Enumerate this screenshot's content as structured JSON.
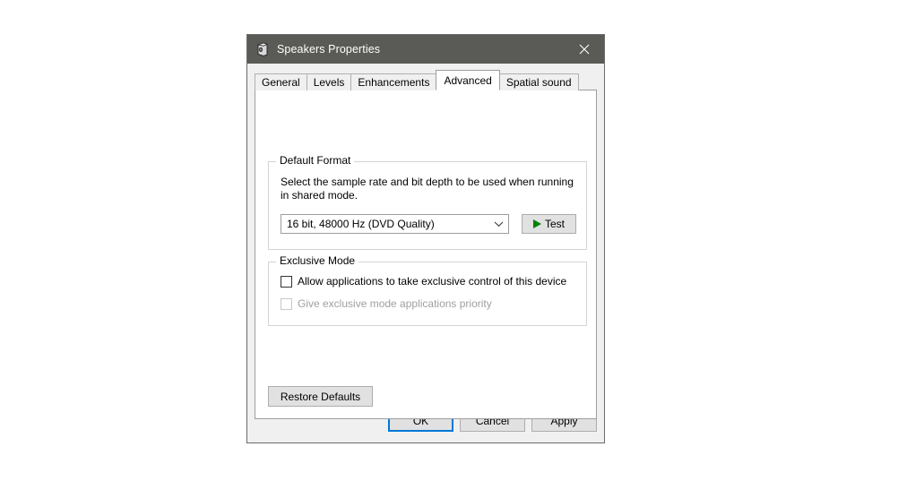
{
  "window": {
    "title": "Speakers Properties",
    "icon": "speaker-device-icon",
    "close_label": "✕",
    "titlebar_color": "#5a5a56"
  },
  "tabs": [
    {
      "label": "General",
      "selected": false
    },
    {
      "label": "Levels",
      "selected": false
    },
    {
      "label": "Enhancements",
      "selected": false
    },
    {
      "label": "Advanced",
      "selected": true
    },
    {
      "label": "Spatial sound",
      "selected": false
    }
  ],
  "default_format": {
    "group_label": "Default Format",
    "description": "Select the sample rate and bit depth to be used when running in shared mode.",
    "combo": {
      "selected": "16 bit, 48000 Hz (DVD Quality)",
      "arrow_icon": "chevron-down-icon"
    },
    "test_button": {
      "label": "Test",
      "icon": "play-icon",
      "icon_color": "#008000"
    }
  },
  "exclusive_mode": {
    "group_label": "Exclusive Mode",
    "checkboxes": [
      {
        "label": "Allow applications to take exclusive control of this device",
        "checked": false,
        "enabled": true
      },
      {
        "label": "Give exclusive mode applications priority",
        "checked": false,
        "enabled": false
      }
    ]
  },
  "restore_defaults": {
    "label": "Restore Defaults"
  },
  "footer": {
    "ok_label": "OK",
    "cancel_label": "Cancel",
    "apply_label": "Apply",
    "focus_color": "#0078d7"
  }
}
